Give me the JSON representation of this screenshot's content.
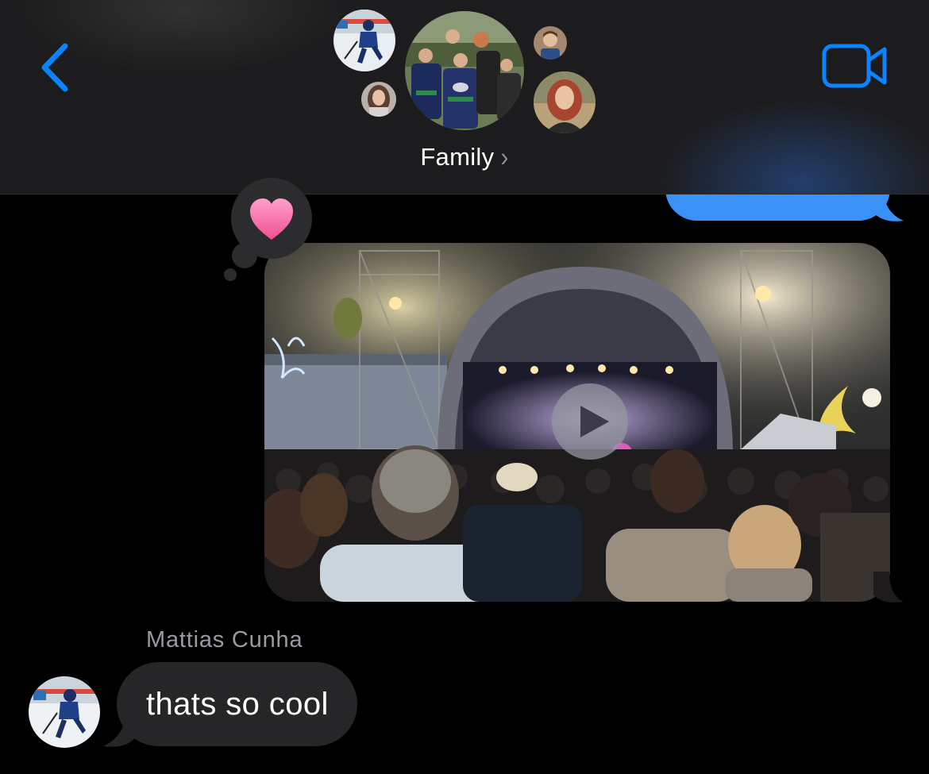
{
  "header": {
    "group_name": "Family",
    "chevron": "›",
    "back_icon": "chevron-left-icon",
    "video_icon": "video-camera-icon",
    "accent_color": "#0a84ff",
    "participants": [
      "hockey-player-avatar",
      "girl-avatar",
      "group-photo-avatar",
      "boy-avatar",
      "woman-avatar"
    ]
  },
  "conversation": {
    "sent_bubble_color": "#3a91f7",
    "received_bubble_color": "#262628",
    "video_message": {
      "reaction": "heart",
      "reaction_icon": "heart-icon",
      "play_icon": "play-icon"
    },
    "received_message": {
      "sender": "Mattias Cunha",
      "text": "thats so cool"
    }
  }
}
